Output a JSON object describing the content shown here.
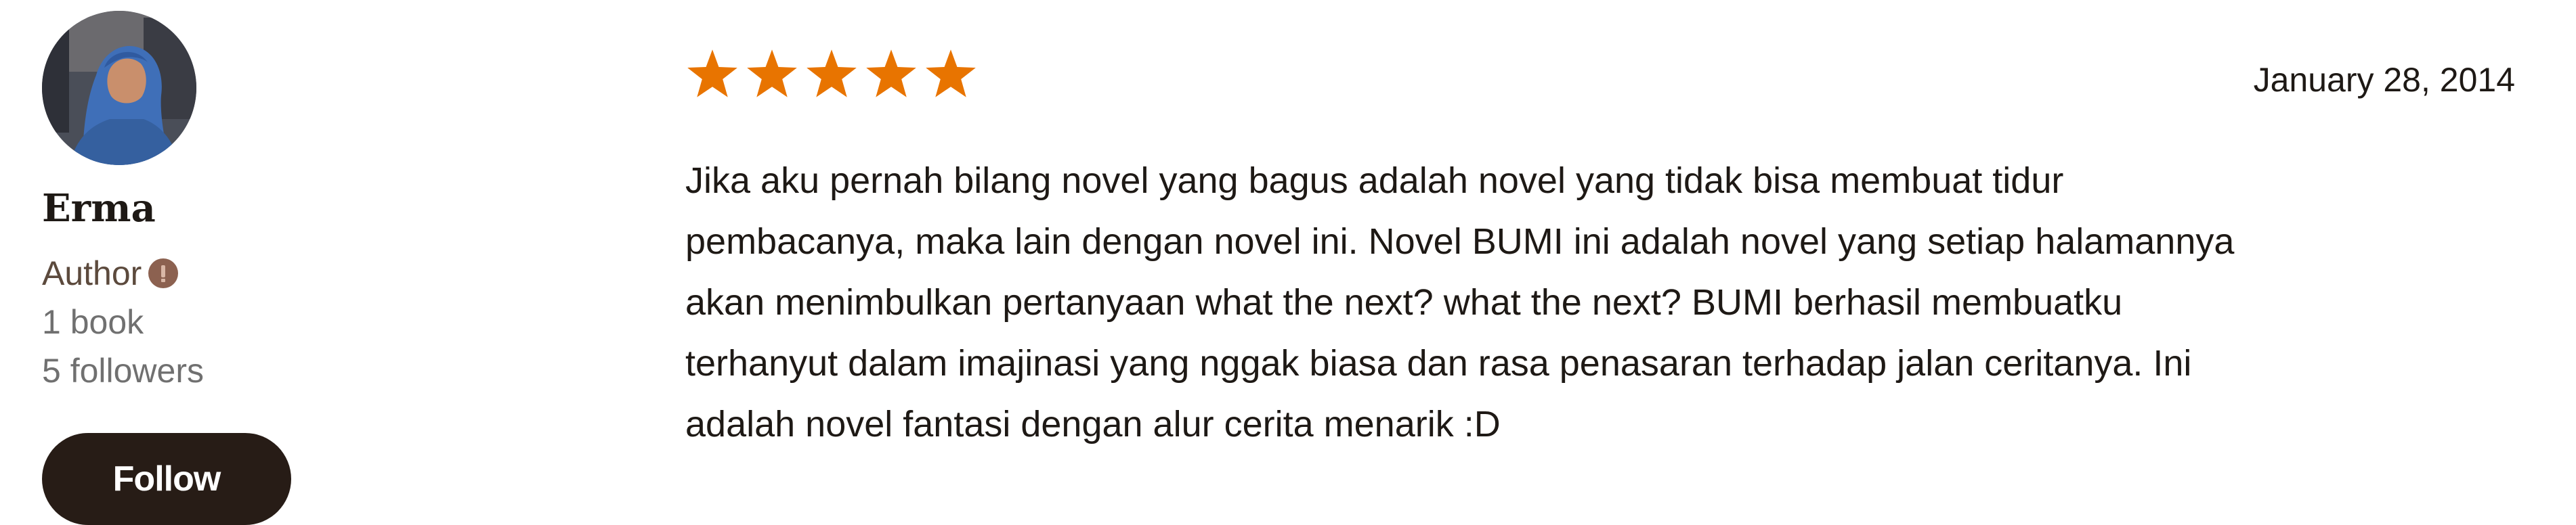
{
  "author": {
    "name": "Erma",
    "role": "Author",
    "books": "1 book",
    "followers": "5 followers",
    "follow_label": "Follow",
    "badge_icon": "author-badge-icon",
    "avatar_icon": "avatar-photo"
  },
  "review": {
    "rating": 5,
    "rating_max": 5,
    "star_color": "#e87400",
    "date": "January 28, 2014",
    "lines": [
      "Jika aku pernah bilang novel yang bagus adalah novel yang tidak bisa membuat tidur",
      "pembacanya, maka lain dengan novel ini. Novel BUMI ini adalah novel yang setiap halamannya",
      "akan menimbulkan pertanyaan what the next? what the next? BUMI berhasil membuatku",
      "terhanyut dalam imajinasi yang nggak biasa dan rasa penasaran terhadap jalan ceritanya. Ini",
      "adalah novel fantasi dengan alur cerita menarik :D"
    ]
  },
  "colors": {
    "button_bg": "#271c16",
    "badge": "#8c6150",
    "muted_text": "#707070"
  }
}
